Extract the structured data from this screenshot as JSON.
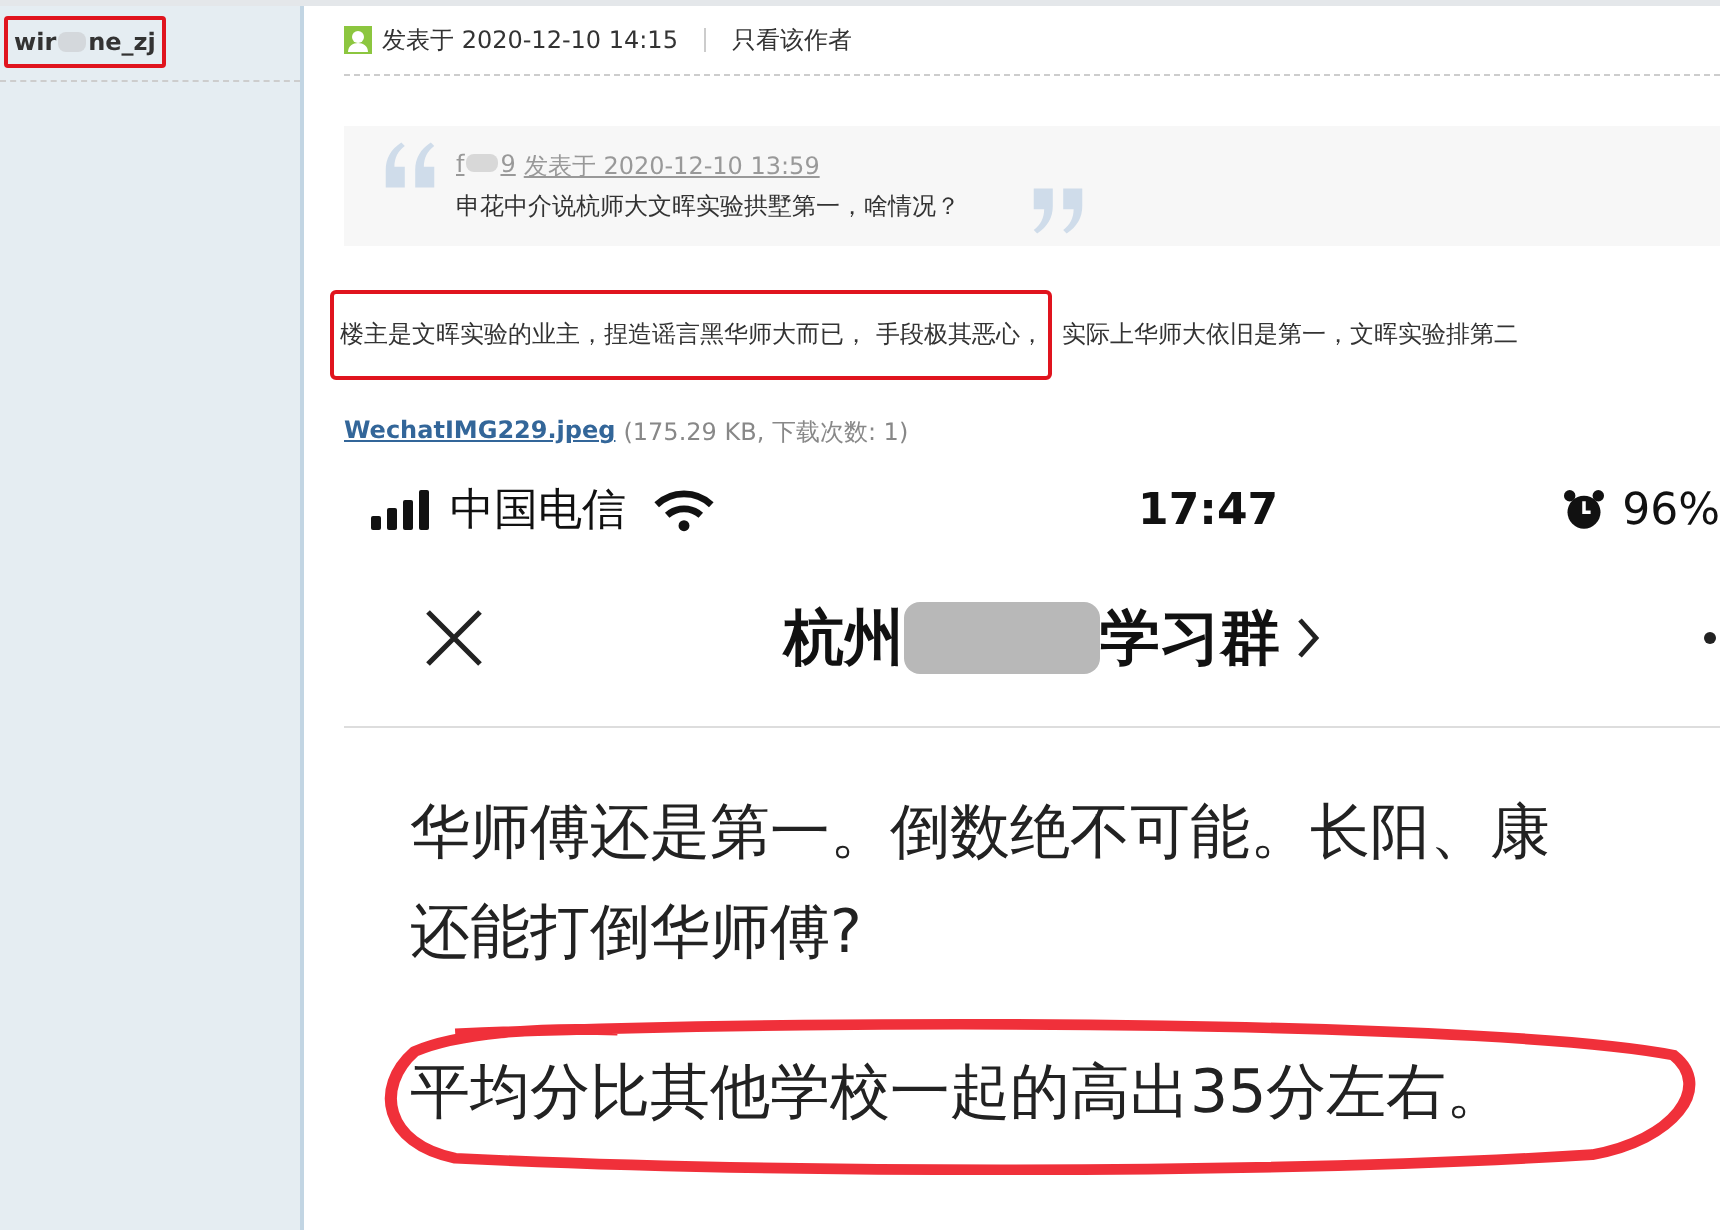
{
  "sidebar": {
    "username_start": "wir",
    "username_end": "ne_zj",
    "highlighted": true
  },
  "post": {
    "posted": "发表于 2020-12-10 14:15",
    "only_author": "只看该作者",
    "quote": {
      "author_start": "f",
      "author_end": "9",
      "posted": "发表于 2020-12-10 13:59",
      "text": "申花中介说杭师大文晖实验拱墅第一，啥情况？"
    },
    "segments": [
      {
        "text": "楼主是文晖实验的业主，捏造谣言黑华师大而已， 手段极其恶心，",
        "highlighted": true
      },
      {
        "text": "实际上华师大依旧是第一，文晖实验排第二",
        "highlighted": false
      }
    ],
    "attachment": {
      "name": "WechatIMG229.jpeg",
      "info": "(175.29 KB, 下载次数: 1)"
    }
  },
  "phone": {
    "carrier": "中国电信",
    "time": "17:47",
    "battery": "96%",
    "chat_title_start": "杭州",
    "chat_title_end": "学习群",
    "lines": [
      {
        "text": "华师傅还是第一。倒数绝不可能。长阳、康",
        "circled": false
      },
      {
        "text": "还能打倒华师傅?",
        "circled": false
      },
      {
        "text": "平均分比其他学校一起的高出35分左右。",
        "circled": true
      }
    ]
  }
}
